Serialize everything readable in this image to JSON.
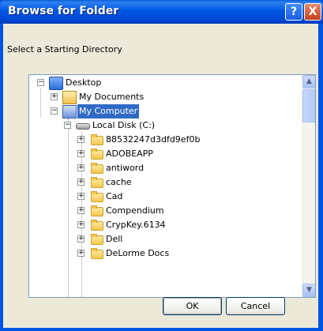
{
  "window": {
    "title": "Browse for Folder"
  },
  "titlebar_buttons": {
    "help": "?",
    "close": "X"
  },
  "prompt": "Select a Starting Directory",
  "tree": {
    "desktop": "Desktop",
    "my_documents": "My Documents",
    "my_computer": "My Computer",
    "local_disk": "Local Disk (C:)",
    "folders": [
      "88532247d3dfd9ef0b",
      "ADOBEAPP",
      "antiword",
      "cache",
      "Cad",
      "Compendium",
      "CrypKey.6134",
      "Dell",
      "DeLorme Docs"
    ]
  },
  "buttons": {
    "ok": "OK",
    "cancel": "Cancel"
  },
  "colors": {
    "selection": "#316ac5",
    "titlebar": "#0054e3"
  }
}
